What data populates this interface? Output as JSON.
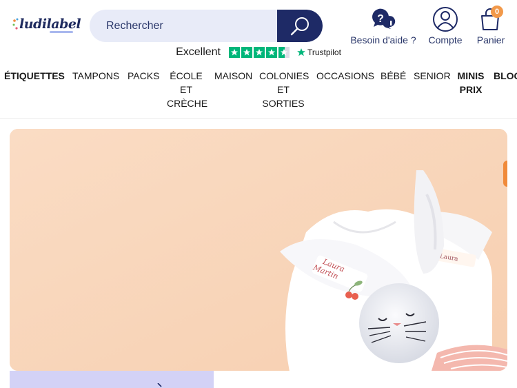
{
  "brand": {
    "logo_text": "ludilabel"
  },
  "search": {
    "placeholder": "Rechercher"
  },
  "header_actions": {
    "help_label": "Besoin d'aide ?",
    "account_label": "Compte",
    "cart_label": "Panier",
    "cart_count": "0"
  },
  "trustpilot": {
    "rating_label": "Excellent",
    "brand": "Trustpilot",
    "stars": 4.5
  },
  "nav": {
    "items": [
      {
        "label": "ÉTIQUETTES",
        "bold": true
      },
      {
        "label": "TAMPONS",
        "bold": false
      },
      {
        "label": "PACKS",
        "bold": false
      },
      {
        "label": "ÉCOLE\nET\nCRÈCHE",
        "bold": false
      },
      {
        "label": "MAISON",
        "bold": false
      },
      {
        "label": "COLONIES\nET\nSORTIES",
        "bold": false
      },
      {
        "label": "OCCASIONS",
        "bold": false
      },
      {
        "label": "BÉBÉ",
        "bold": false
      },
      {
        "label": "SENIOR",
        "bold": false
      },
      {
        "label": "MINIS\nPRIX",
        "bold": true
      },
      {
        "label": "BLOG",
        "bold": true
      }
    ]
  },
  "hero": {
    "label_name": "Laura\nMartin",
    "bodysuit_label": "Laura"
  },
  "colors": {
    "brand_navy": "#1e2a66",
    "search_bg": "#e8ebf8",
    "trustpilot_green": "#00b67a",
    "cart_badge": "#f2994a",
    "hero_bg": "#f9d7bd",
    "promo_bg": "#d3d2f6"
  }
}
